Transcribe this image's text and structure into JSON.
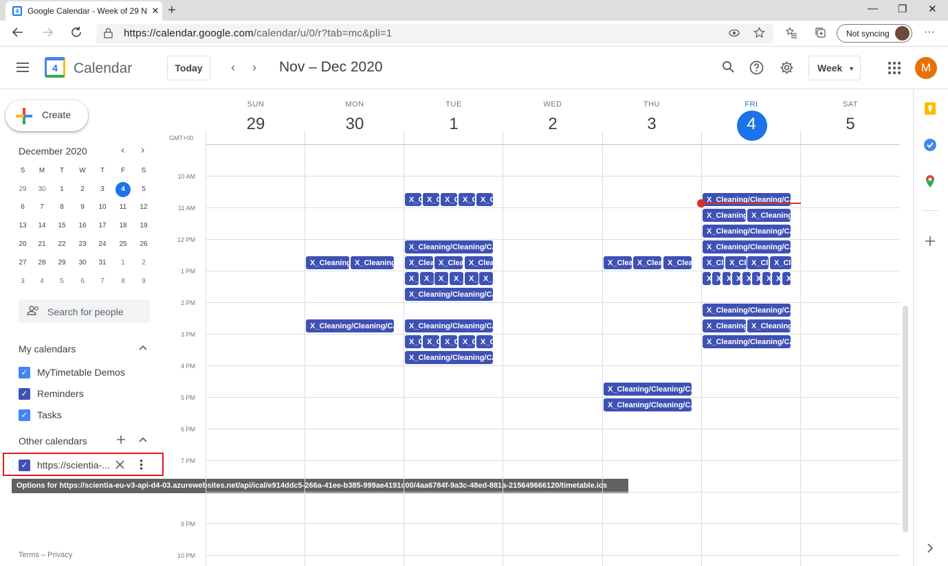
{
  "browser": {
    "tab_title": "Google Calendar - Week of 29 N",
    "tab_close": "✕",
    "new_tab": "+",
    "url_host": "https://calendar.google.com",
    "url_path": "/calendar/u/0/r?tab=mc&pli=1",
    "sync_label": "Not syncing",
    "minimize": "—",
    "restore": "❐",
    "close": "✕",
    "more": "···"
  },
  "header": {
    "app_title": "Calendar",
    "logo_day": "4",
    "today_label": "Today",
    "prev": "‹",
    "next": "›",
    "date_range": "Nov – Dec 2020",
    "view_label": "Week",
    "avatar_letter": "M"
  },
  "sidebar": {
    "create_label": "Create",
    "mini_cal_month": "December 2020",
    "mini_prev": "‹",
    "mini_next": "›",
    "weekday_headers": [
      "S",
      "M",
      "T",
      "W",
      "T",
      "F",
      "S"
    ],
    "weeks": [
      [
        "29",
        "30",
        "1",
        "2",
        "3",
        "4",
        "5"
      ],
      [
        "6",
        "7",
        "8",
        "9",
        "10",
        "11",
        "12"
      ],
      [
        "13",
        "14",
        "15",
        "16",
        "17",
        "18",
        "19"
      ],
      [
        "20",
        "21",
        "22",
        "23",
        "24",
        "25",
        "26"
      ],
      [
        "27",
        "28",
        "29",
        "30",
        "31",
        "1",
        "2"
      ],
      [
        "3",
        "4",
        "5",
        "6",
        "7",
        "8",
        "9"
      ]
    ],
    "search_people_placeholder": "Search for people",
    "my_calendars_title": "My calendars",
    "my_calendars": [
      {
        "label": "MyTimetable Demos",
        "color": "#4285f4"
      },
      {
        "label": "Reminders",
        "color": "#3f51b5"
      },
      {
        "label": "Tasks",
        "color": "#4285f4"
      }
    ],
    "other_calendars_title": "Other calendars",
    "other_calendar": {
      "label": "https://scientia-...",
      "color": "#3f51b5"
    },
    "tooltip": "Options for https://scientia-eu-v3-api-d4-03.azurewebsites.net/api/ical/e914ddc5-266a-41ee-b385-999ae4191c00/4aa6784f-9a3c-48ed-881a-215649666120/timetable.ics",
    "terms": "Terms – Privacy"
  },
  "grid": {
    "timezone": "GMT+00",
    "days": [
      {
        "name": "SUN",
        "num": "29"
      },
      {
        "name": "MON",
        "num": "30"
      },
      {
        "name": "TUE",
        "num": "1"
      },
      {
        "name": "WED",
        "num": "2"
      },
      {
        "name": "THU",
        "num": "3"
      },
      {
        "name": "FRI",
        "num": "4",
        "today": true
      },
      {
        "name": "SAT",
        "num": "5"
      }
    ],
    "times": [
      "10 AM",
      "11 AM",
      "12 PM",
      "1 PM",
      "2 PM",
      "3 PM",
      "4 PM",
      "5 PM",
      "6 PM",
      "7 PM",
      "9 PM",
      "10 PM"
    ],
    "event_title": "X_Cleaning/Cleaning/CA",
    "event_color": "#3f51b5"
  }
}
